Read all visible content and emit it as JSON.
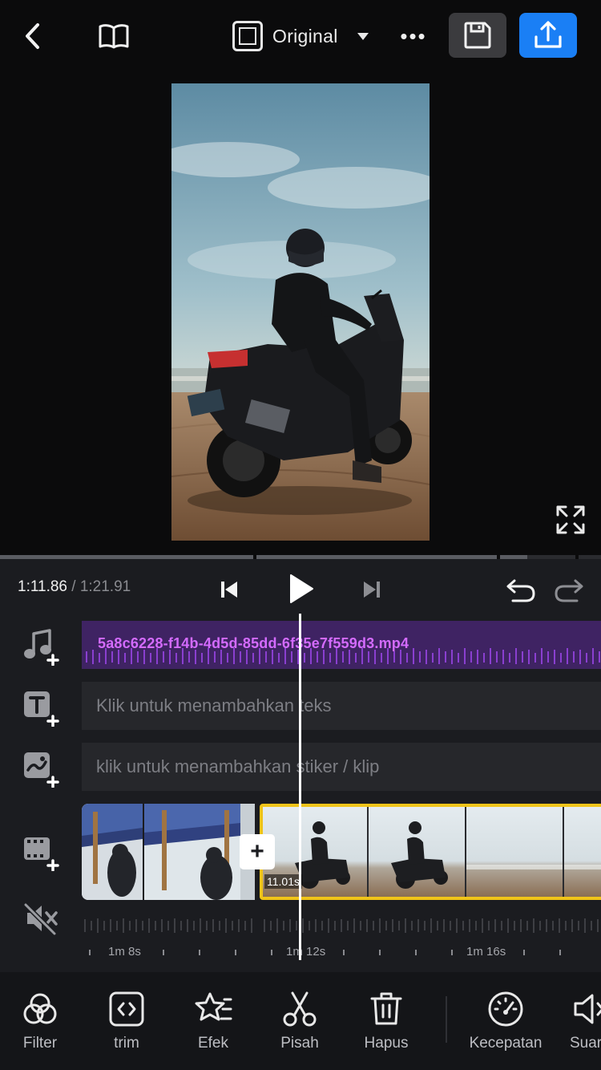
{
  "header": {
    "aspect_label": "Original",
    "more_label": "•••"
  },
  "transport": {
    "current_time": "1:11.86",
    "separator": "/",
    "total_time": "1:21.91"
  },
  "timeline": {
    "audio_track_label": "5a8c6228-f14b-4d5d-85dd-6f35e7f559d3.mp4",
    "text_track_placeholder": "Klik untuk menambahkan teks",
    "sticker_track_placeholder": "klik untuk menambahkan stiker / klip",
    "selected_clip_duration": "11.01s",
    "add_transition_label": "+",
    "ruler_labels": [
      "1m 8s",
      "1m 12s",
      "1m 16s"
    ]
  },
  "toolbar": {
    "items": [
      {
        "label": "Filter",
        "icon": "filter-icon"
      },
      {
        "label": "trim",
        "icon": "trim-icon"
      },
      {
        "label": "Efek",
        "icon": "effects-icon"
      },
      {
        "label": "Pisah",
        "icon": "scissors-icon"
      },
      {
        "label": "Hapus",
        "icon": "trash-icon"
      },
      {
        "label": "Kecepatan",
        "icon": "speedometer-icon"
      },
      {
        "label": "Suara",
        "icon": "volume-icon"
      }
    ]
  },
  "colors": {
    "export_accent": "#1a7ff5",
    "audio_track_bg": "#3f2363",
    "audio_track_text": "#d46bff",
    "selected_clip_border": "#f0c419"
  }
}
